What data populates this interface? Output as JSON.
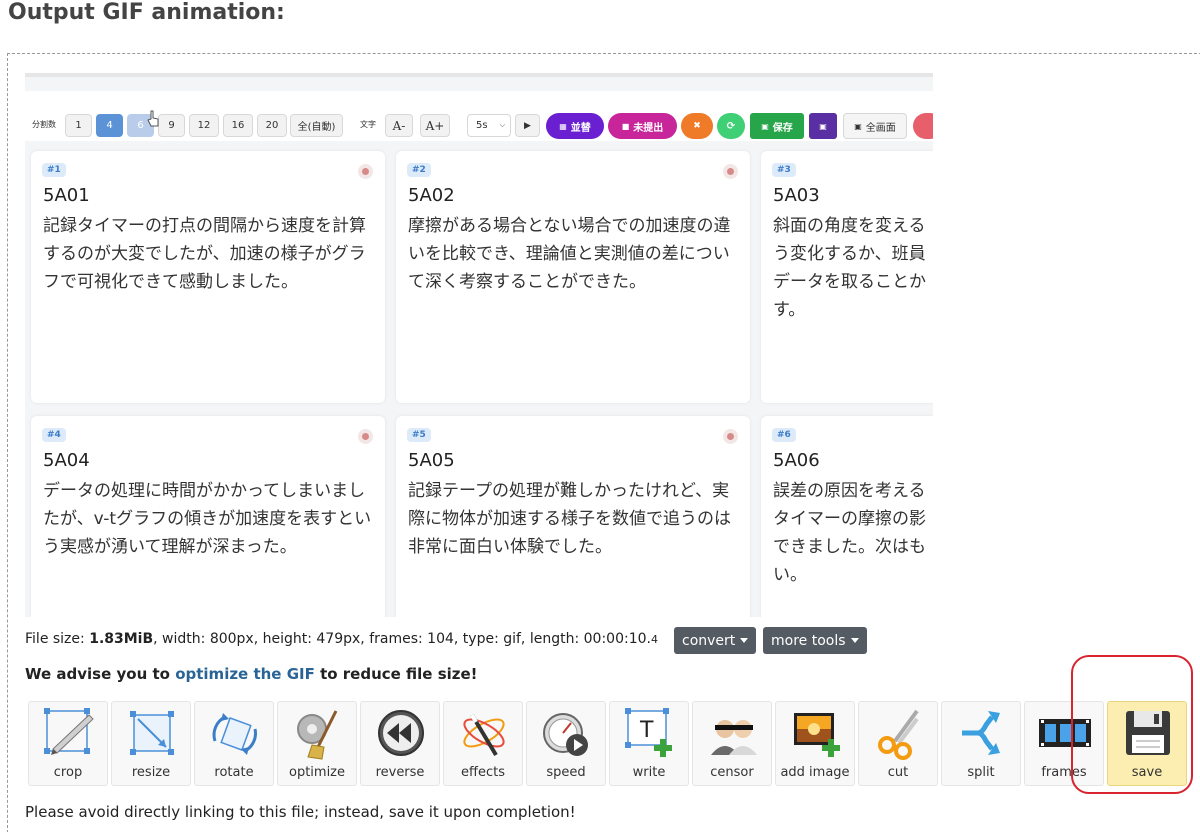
{
  "heading": "Output GIF animation:",
  "toolbar": {
    "split_label": "分割数",
    "split_buttons": [
      "1",
      "4",
      "6",
      "9",
      "12",
      "16",
      "20",
      "全(自動)"
    ],
    "text_label": "文字",
    "font_small": "A-",
    "font_large": "A+",
    "interval": "5s",
    "play_icon": "play-icon",
    "sort_label": "並替",
    "unsubmitted_label": "未提出",
    "save_label": "保存",
    "fullscreen_label": "全画面"
  },
  "cards": [
    {
      "num": "#1",
      "title": "5A01",
      "text": "記録タイマーの打点の間隔から速度を計算するのが大変でしたが、加速の様子がグラフで可視化できて感動しました。"
    },
    {
      "num": "#2",
      "title": "5A02",
      "text": "摩擦がある場合とない場合での加速度の違いを比較でき、理論値と実測値の差について深く考察することができた。"
    },
    {
      "num": "#3",
      "title": "5A03",
      "text": "斜面の角度を変える\nう変化するか、班員\nデータを取ることか\nす。"
    },
    {
      "num": "#4",
      "title": "5A04",
      "text": "データの処理に時間がかかってしまいましたが、v-tグラフの傾きが加速度を表すという実感が湧いて理解が深まった。"
    },
    {
      "num": "#5",
      "title": "5A05",
      "text": "記録テープの処理が難しかったけれど、実際に物体が加速する様子を数値で追うのは非常に面白い体験でした。"
    },
    {
      "num": "#6",
      "title": "5A06",
      "text": "誤差の原因を考える\nタイマーの摩擦の影\nできました。次はも\nい。"
    }
  ],
  "info": {
    "file_size_label": "File size: ",
    "file_size": "1.83MiB",
    "rest": ", width: 800px, height: 479px, frames: 104, type: gif, length: 00:00:10.",
    "rest_small": "4"
  },
  "convert_label": "convert",
  "more_tools_label": "more tools",
  "advise": {
    "before": "We advise you to ",
    "link": "optimize the GIF",
    "after": " to reduce file size!"
  },
  "tools": [
    {
      "label": "crop",
      "icon": "crop-icon"
    },
    {
      "label": "resize",
      "icon": "resize-icon"
    },
    {
      "label": "rotate",
      "icon": "rotate-icon"
    },
    {
      "label": "optimize",
      "icon": "optimize-icon"
    },
    {
      "label": "reverse",
      "icon": "reverse-icon"
    },
    {
      "label": "effects",
      "icon": "effects-icon"
    },
    {
      "label": "speed",
      "icon": "speed-icon"
    },
    {
      "label": "write",
      "icon": "write-icon"
    },
    {
      "label": "censor",
      "icon": "censor-icon"
    },
    {
      "label": "add image",
      "icon": "add-image-icon"
    },
    {
      "label": "cut",
      "icon": "cut-icon"
    },
    {
      "label": "split",
      "icon": "split-icon"
    },
    {
      "label": "frames",
      "icon": "frames-icon"
    },
    {
      "label": "save",
      "icon": "save-icon"
    }
  ],
  "note": "Please avoid directly linking to this file; instead, save it upon completion!",
  "colors": {
    "accent_link": "#2a6496",
    "highlight_ring": "#d9232e",
    "save_active": "#fbeeb0",
    "pill_purple": "#6a1fd0",
    "pill_magenta": "#c9259b",
    "pill_orange": "#ef7b28",
    "pill_green": "#3fcf74",
    "save_green": "#27a54a"
  }
}
